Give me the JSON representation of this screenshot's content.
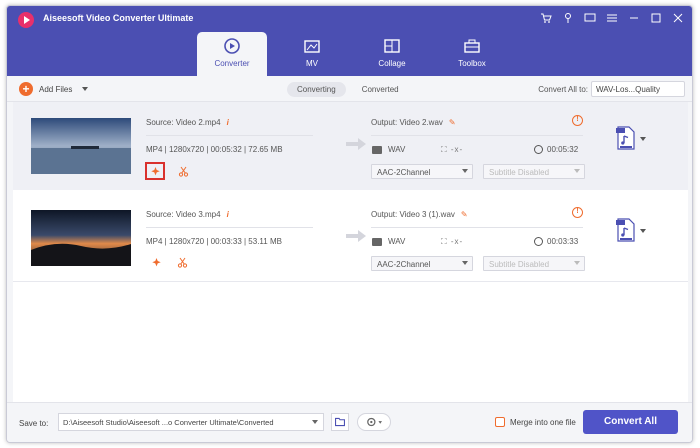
{
  "app": {
    "title": "Aiseesoft Video Converter Ultimate"
  },
  "window_controls": [
    "cart-icon",
    "key-icon",
    "chat-icon",
    "menu-icon",
    "minimize-icon",
    "maximize-icon",
    "close-icon"
  ],
  "tabs": [
    {
      "label": "Converter",
      "icon": "converter-icon",
      "active": true
    },
    {
      "label": "MV",
      "icon": "mv-icon",
      "active": false
    },
    {
      "label": "Collage",
      "icon": "collage-icon",
      "active": false
    },
    {
      "label": "Toolbox",
      "icon": "toolbox-icon",
      "active": false
    }
  ],
  "toolbar": {
    "add_files": "Add Files",
    "converting": "Converting",
    "converted": "Converted",
    "convert_all_to": "Convert All to:",
    "format": "WAV-Los...Quality"
  },
  "items": [
    {
      "source": "Source: Video 2.mp4",
      "meta": "MP4  |  1280x720  |  00:05:32  |  72.65 MB",
      "output": "Output: Video 2.wav",
      "out_format": "WAV",
      "dims": "⛶  -x-",
      "duration": "00:05:32",
      "audio": "AAC-2Channel",
      "subtitle": "Subtitle Disabled"
    },
    {
      "source": "Source: Video 3.mp4",
      "meta": "MP4  |  1280x720  |  00:03:33  |  53.11 MB",
      "output": "Output: Video 3 (1).wav",
      "out_format": "WAV",
      "dims": "⛶  -x-",
      "duration": "00:03:33",
      "audio": "AAC-2Channel",
      "subtitle": "Subtitle Disabled"
    }
  ],
  "footer": {
    "save_to": "Save to:",
    "path": "D:\\Aiseesoft Studio\\Aiseesoft ...o Converter Ultimate\\Converted",
    "merge": "Merge into one file",
    "convert_all": "Convert All"
  },
  "colors": {
    "header": "#4b4fb2",
    "accent": "#ef6c2e",
    "button": "#5054c8"
  }
}
